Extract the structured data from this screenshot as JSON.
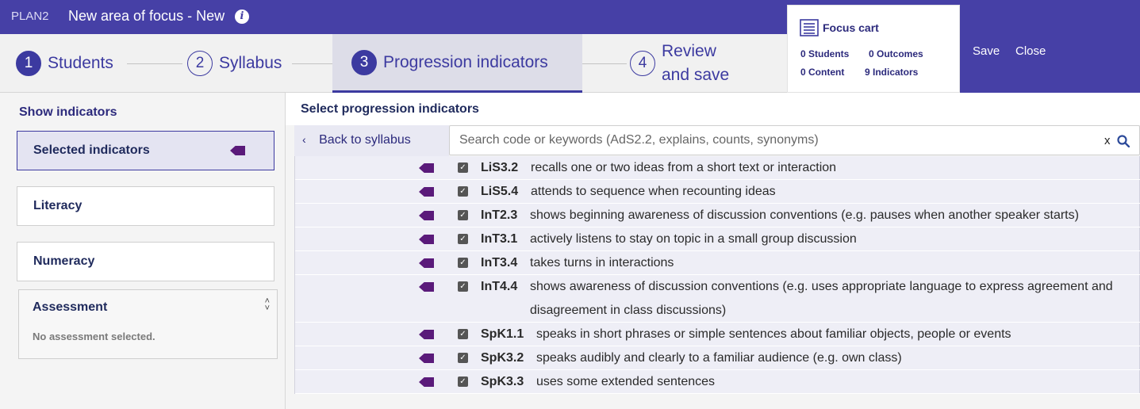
{
  "app": {
    "name": "PLAN2",
    "title": "New area of focus - New"
  },
  "steps": [
    {
      "num": "1",
      "label": "Students"
    },
    {
      "num": "2",
      "label": "Syllabus"
    },
    {
      "num": "3",
      "label": "Progression indicators"
    },
    {
      "num": "4",
      "label_line1": "Review",
      "label_line2": "and save"
    }
  ],
  "cart": {
    "title": "Focus cart",
    "students": "0 Students",
    "outcomes": "0 Outcomes",
    "content": "0 Content",
    "indicators": "9 Indicators"
  },
  "actions": {
    "save": "Save",
    "close": "Close"
  },
  "sidebar": {
    "heading": "Show indicators",
    "filters": [
      {
        "label": "Selected indicators"
      },
      {
        "label": "Literacy"
      },
      {
        "label": "Numeracy"
      }
    ],
    "assessment": {
      "title": "Assessment",
      "empty": "No assessment selected."
    }
  },
  "main": {
    "title": "Select progression indicators",
    "back_label": "Back to syllabus",
    "search": {
      "placeholder": "Search code or keywords (AdS2.2, explains, counts, synonyms)",
      "clear": "x"
    },
    "indicators": [
      {
        "code": "LiS3.2",
        "text": "recalls one or two ideas from a short text or interaction"
      },
      {
        "code": "LiS5.4",
        "text": "attends to sequence when recounting ideas"
      },
      {
        "code": "InT2.3",
        "text": "shows beginning awareness of discussion conventions (e.g. pauses when another speaker starts)"
      },
      {
        "code": "InT3.1",
        "text": "actively listens to stay on topic in a small group discussion"
      },
      {
        "code": "InT3.4",
        "text": "takes turns in interactions"
      },
      {
        "code": "InT4.4",
        "text": "shows awareness of discussion conventions (e.g. uses appropriate language to express agreement and",
        "text2": "disagreement in class discussions)"
      },
      {
        "code": "SpK1.1",
        "text": "speaks in short phrases or simple sentences about familiar objects, people or events"
      },
      {
        "code": "SpK3.2",
        "text": "speaks audibly and clearly to a familiar audience (e.g. own class)"
      },
      {
        "code": "SpK3.3",
        "text": "uses some extended sentences"
      }
    ],
    "check_glyph": "✓"
  },
  "colors": {
    "brand": "#4640a6",
    "accent": "#3c3aa0",
    "tag": "#5a1a7a"
  }
}
